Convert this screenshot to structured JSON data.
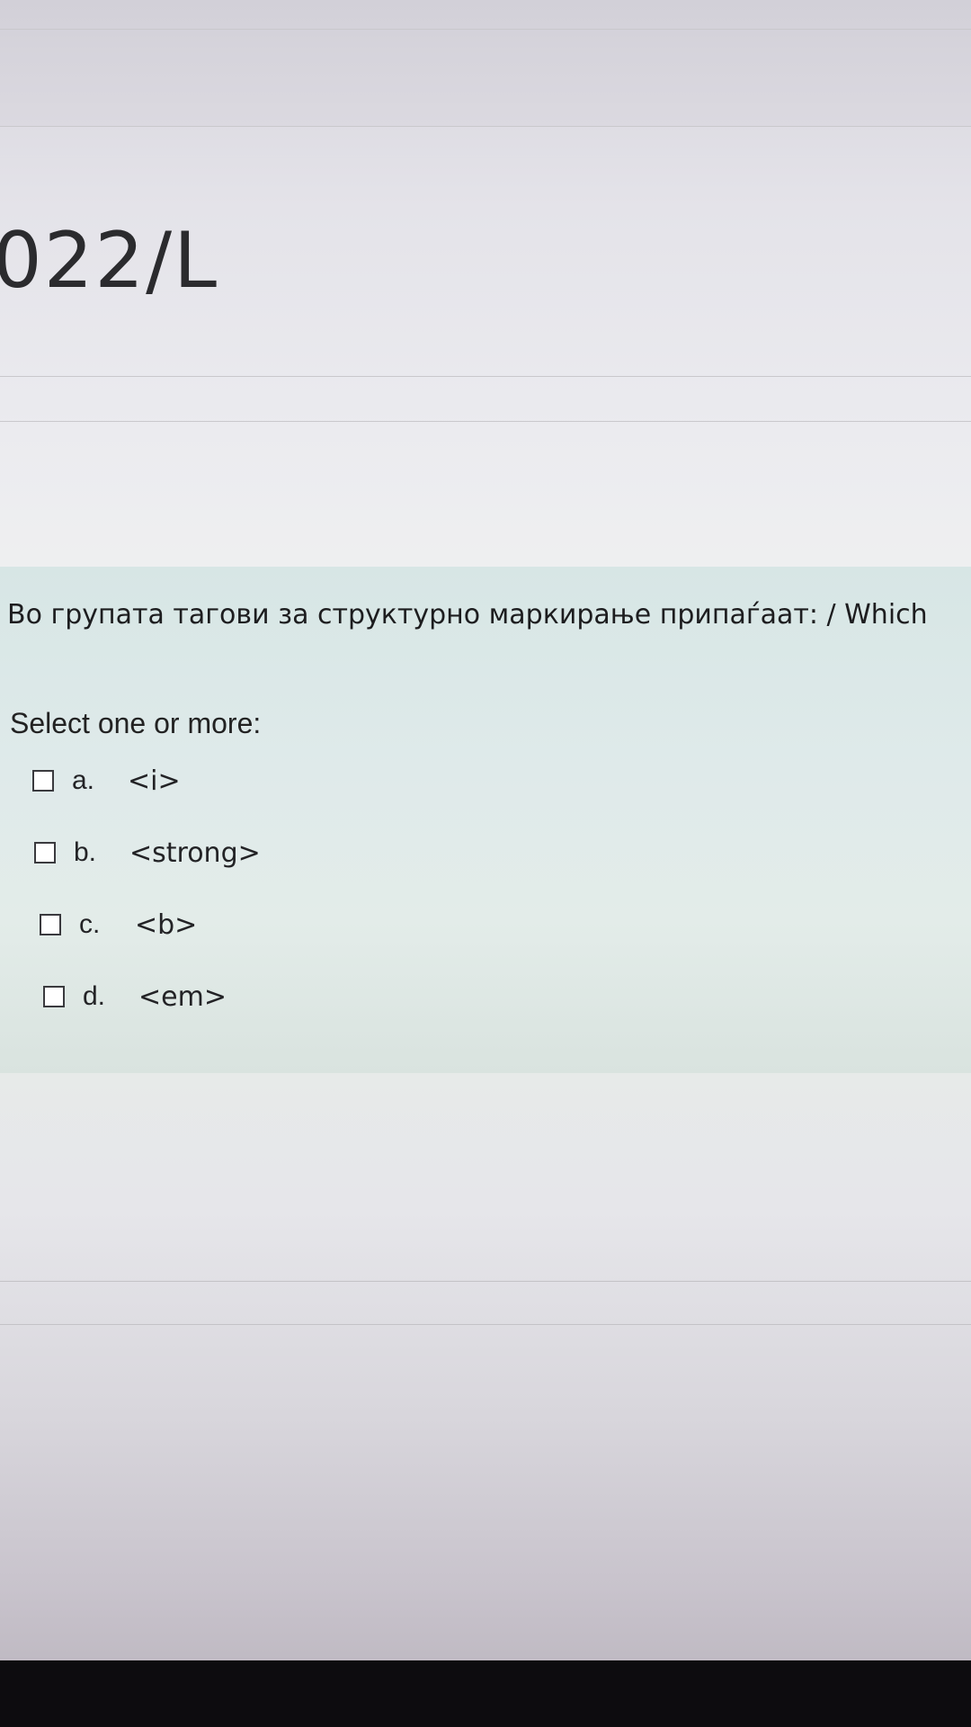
{
  "header": {
    "course_title_fragment": "022/L"
  },
  "question": {
    "text": "Во групата тагови за структурно маркирање припаѓаат: / Which",
    "prompt": "Select one or more:",
    "options": [
      {
        "letter": "a.",
        "text": "<i>",
        "checked": false
      },
      {
        "letter": "b.",
        "text": "<strong>",
        "checked": false
      },
      {
        "letter": "c.",
        "text": "<b>",
        "checked": false
      },
      {
        "letter": "d.",
        "text": "<em>",
        "checked": false
      }
    ]
  }
}
